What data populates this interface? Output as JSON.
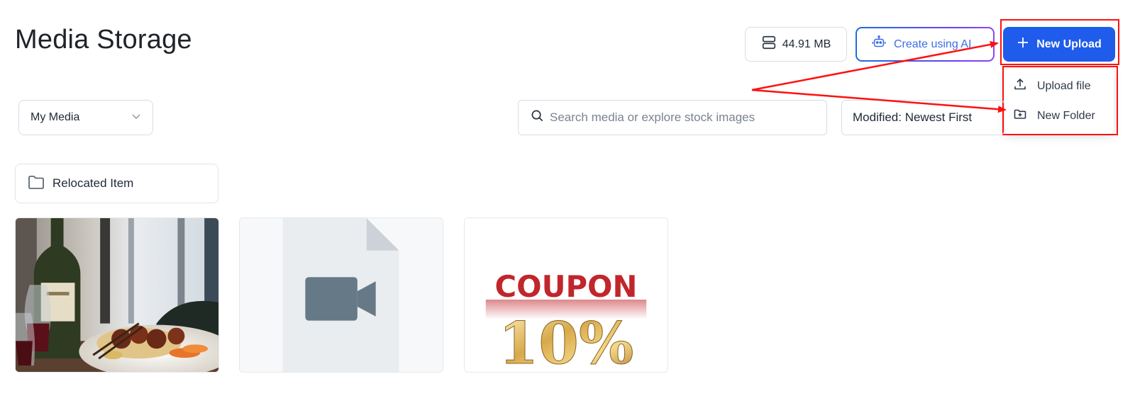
{
  "header": {
    "title": "Media Storage",
    "storage_used": "44.91 MB",
    "ai_button_label": "Create using AI",
    "upload_button_label": "New Upload"
  },
  "upload_menu": {
    "items": [
      {
        "label": "Upload file",
        "icon": "upload-icon"
      },
      {
        "label": "New Folder",
        "icon": "folder-plus-icon"
      }
    ]
  },
  "toolbar": {
    "filter_value": "My Media",
    "search_placeholder": "Search media or explore stock images",
    "sort_value": "Modified: Newest First"
  },
  "folders": [
    {
      "name": "Relocated Item",
      "icon": "folder-icon"
    }
  ],
  "media": [
    {
      "type": "image",
      "subject": "wine-dinner-photo"
    },
    {
      "type": "video",
      "icon": "video-camera-icon"
    },
    {
      "type": "image",
      "subject": "coupon-image",
      "text_main": "COUPON",
      "text_sub": "10%"
    }
  ],
  "colors": {
    "primary": "#1f5ceb",
    "annotation": "#ff1010",
    "ai_gradient_start": "#1c6fd8",
    "ai_gradient_end": "#8f45f0"
  }
}
